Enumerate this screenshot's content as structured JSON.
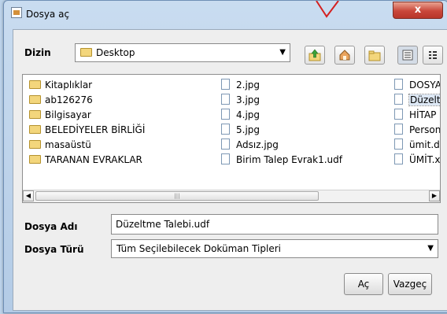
{
  "window": {
    "title": "Dosya aç",
    "close_label": "x"
  },
  "directory": {
    "label": "Dizin",
    "value": "Desktop"
  },
  "toolbar": {
    "up": "up-folder",
    "home": "home",
    "new_folder": "new-folder",
    "list_view": "list-view",
    "details_view": "details-view"
  },
  "files": {
    "col1": [
      "Kitaplıklar",
      "ab126276",
      "Bilgisayar",
      "BELEDİYELER BİRLİĞİ",
      "masaüstü",
      "TARANAN EVRAKLAR"
    ],
    "col2": [
      "2.jpg",
      "3.jpg",
      "4.jpg",
      "5.jpg",
      "Adsız.jpg",
      "Birim Talep Evrak1.udf"
    ],
    "col3": [
      "DOSYA.",
      "Düzeltme",
      "HİTAP H.",
      "Persone",
      "ümit.doc",
      "ÜMİT.xls"
    ]
  },
  "filename": {
    "label": "Dosya Adı",
    "value": "Düzeltme Talebi.udf"
  },
  "filetype": {
    "label": "Dosya Türü",
    "value": "Tüm Seçilebilecek Doküman Tipleri"
  },
  "buttons": {
    "open": "Aç",
    "cancel": "Vazgeç"
  },
  "colors": {
    "accent_red": "#d42020",
    "selection": "#dde8f5"
  }
}
